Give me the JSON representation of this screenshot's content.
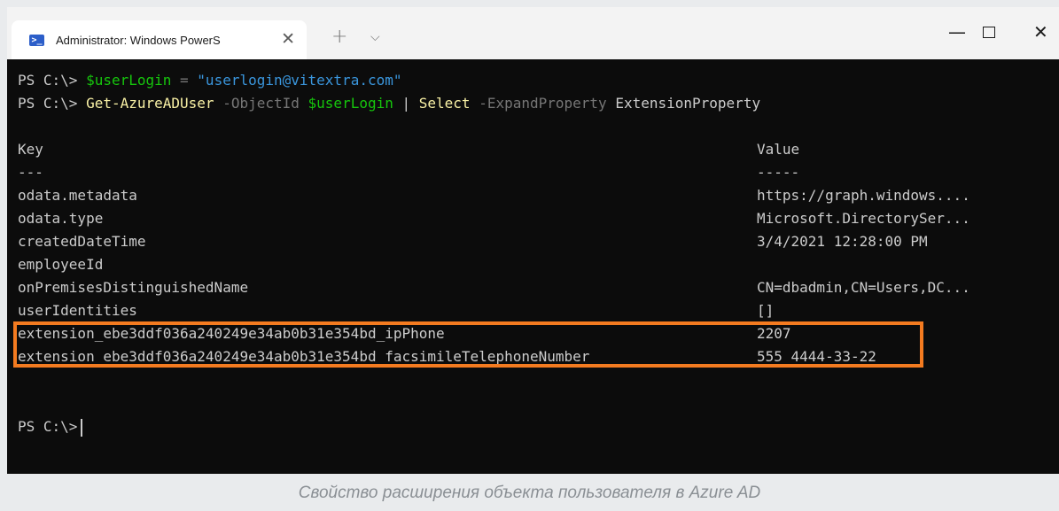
{
  "window": {
    "tab_title": "Administrator: Windows PowerS",
    "tab_icon": "powershell-icon",
    "tab_close": "✕",
    "new_tab": "+",
    "dropdown": "⌵",
    "minimize": "—",
    "close": "✕"
  },
  "terminal": {
    "line1": {
      "prompt": "PS C:\\> ",
      "var": "$userLogin",
      "op": " = ",
      "string": "\"userlogin@vitextra.com\""
    },
    "line2": {
      "prompt": "PS C:\\> ",
      "cmd": "Get-AzureADUser",
      "param1": " -ObjectId ",
      "var": "$userLogin",
      "pipe": " | ",
      "cmd2": "Select",
      "param2": " -ExpandProperty",
      "arg": " ExtensionProperty"
    },
    "header": {
      "key": "Key",
      "value": "Value"
    },
    "separator": {
      "key": "---",
      "value": "-----"
    },
    "rows": [
      {
        "key": "odata.metadata",
        "value": "https://graph.windows...."
      },
      {
        "key": "odata.type",
        "value": "Microsoft.DirectorySer..."
      },
      {
        "key": "createdDateTime",
        "value": "3/4/2021 12:28:00 PM"
      },
      {
        "key": "employeeId",
        "value": ""
      },
      {
        "key": "onPremisesDistinguishedName",
        "value": "CN=dbadmin,CN=Users,DC..."
      },
      {
        "key": "userIdentities",
        "value": "[]"
      },
      {
        "key": "extension_ebe3ddf036a240249e34ab0b31e354bd_ipPhone",
        "value": "2207"
      },
      {
        "key": "extension_ebe3ddf036a240249e34ab0b31e354bd_facsimileTelephoneNumber",
        "value": "555 4444-33-22"
      }
    ],
    "final_prompt": "PS C:\\>",
    "highlight_color": "#f47b20"
  },
  "caption": "Свойство расширения объекта пользователя в Azure AD"
}
